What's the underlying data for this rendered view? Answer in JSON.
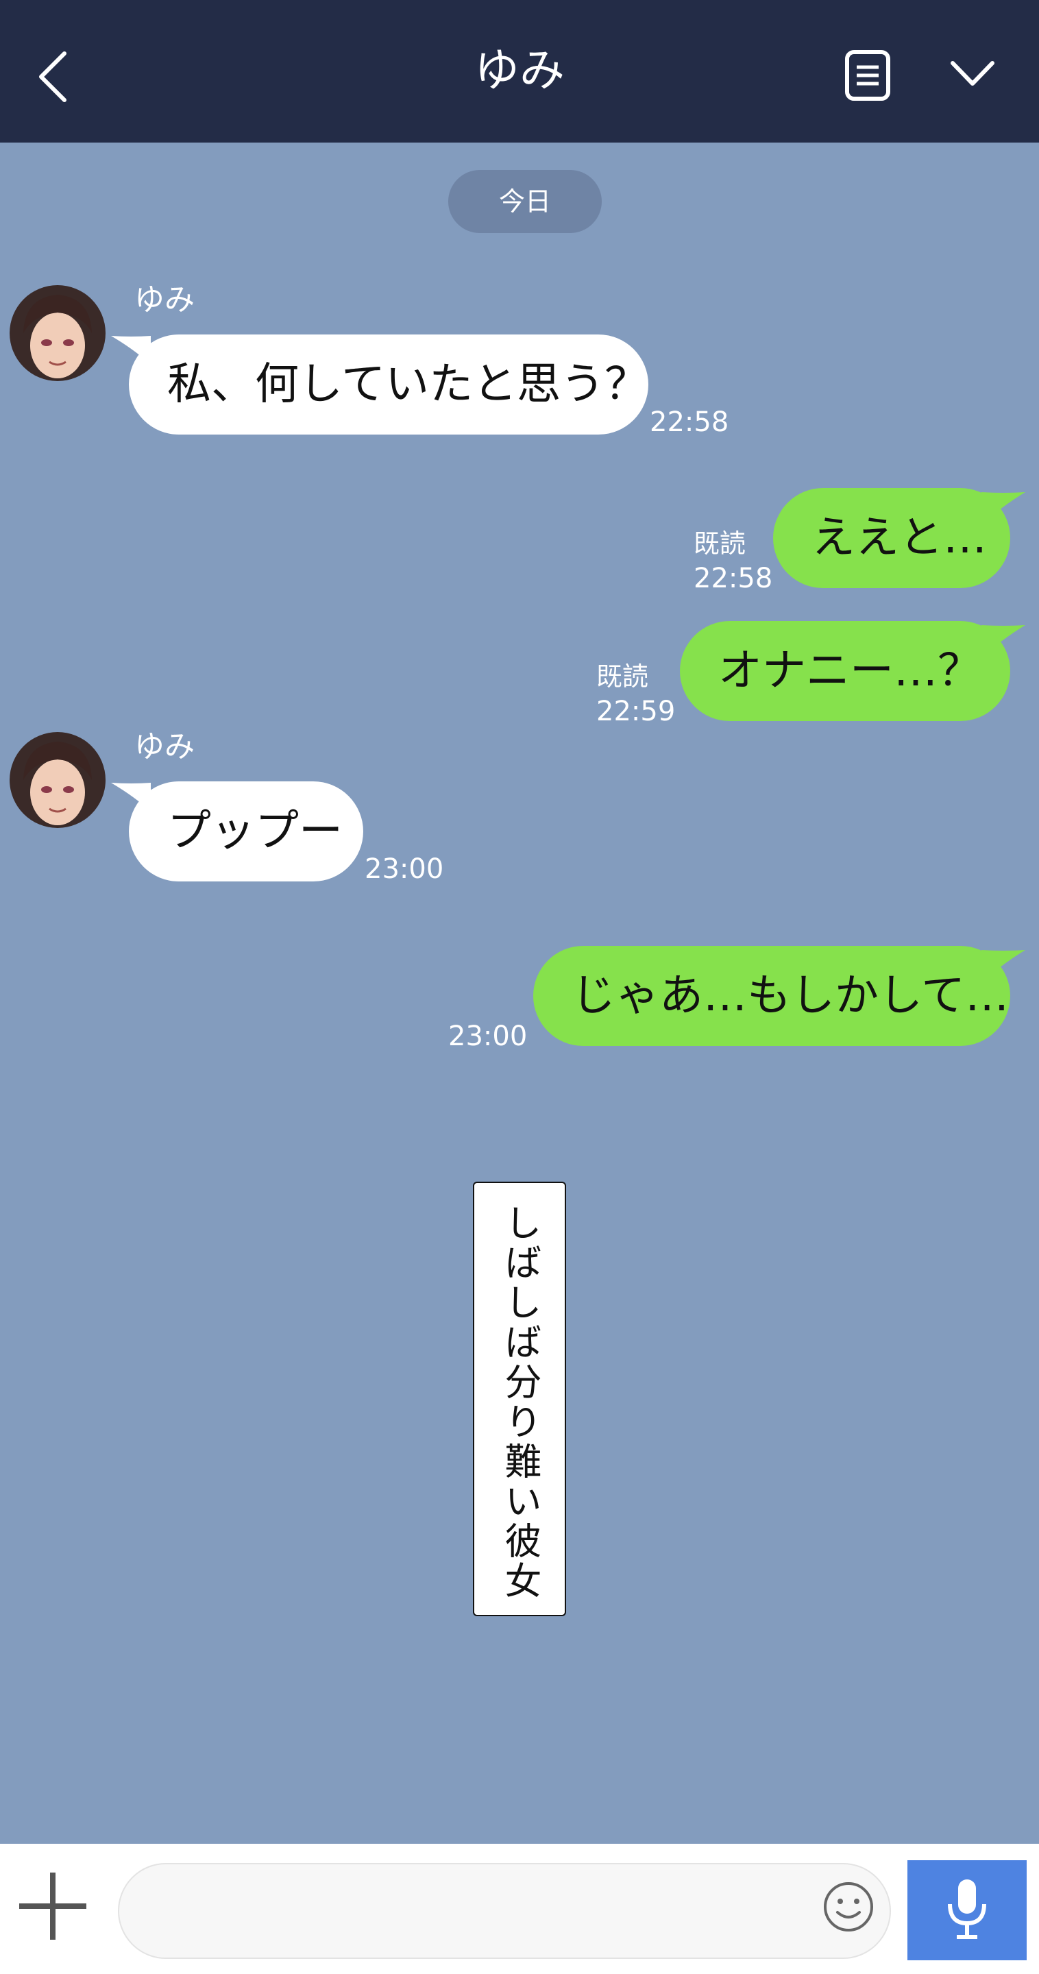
{
  "header": {
    "title": "ゆみ",
    "back_icon": "chevron-left-icon",
    "notes_icon": "notes-icon",
    "menu_icon": "chevron-down-icon",
    "bg_color": "#232c47"
  },
  "date_label": "今日",
  "chat": {
    "bg_color": "#839cbe",
    "messages": [
      {
        "direction": "in",
        "sender": "ゆみ",
        "text": "私、何していたと思う？",
        "time": "22:58",
        "read": ""
      },
      {
        "direction": "out",
        "text": "ええと…",
        "time": "22:58",
        "read": "既読"
      },
      {
        "direction": "out",
        "text": "オナニー…？",
        "time": "22:59",
        "read": "既読"
      },
      {
        "direction": "in",
        "sender": "ゆみ",
        "text": "プップー",
        "time": "23:00",
        "read": ""
      },
      {
        "direction": "out",
        "text": "じゃあ…もしかして…",
        "time": "23:00",
        "read": ""
      }
    ],
    "incoming_bubble_color": "#ffffff",
    "outgoing_bubble_color": "#86e14c"
  },
  "caption": "しばしば分り難い彼女",
  "composer": {
    "input_value": "",
    "input_placeholder": "",
    "plus_icon": "plus-icon",
    "emoji_icon": "emoji-icon",
    "mic_icon": "microphone-icon",
    "mic_color": "#4e83e1"
  }
}
